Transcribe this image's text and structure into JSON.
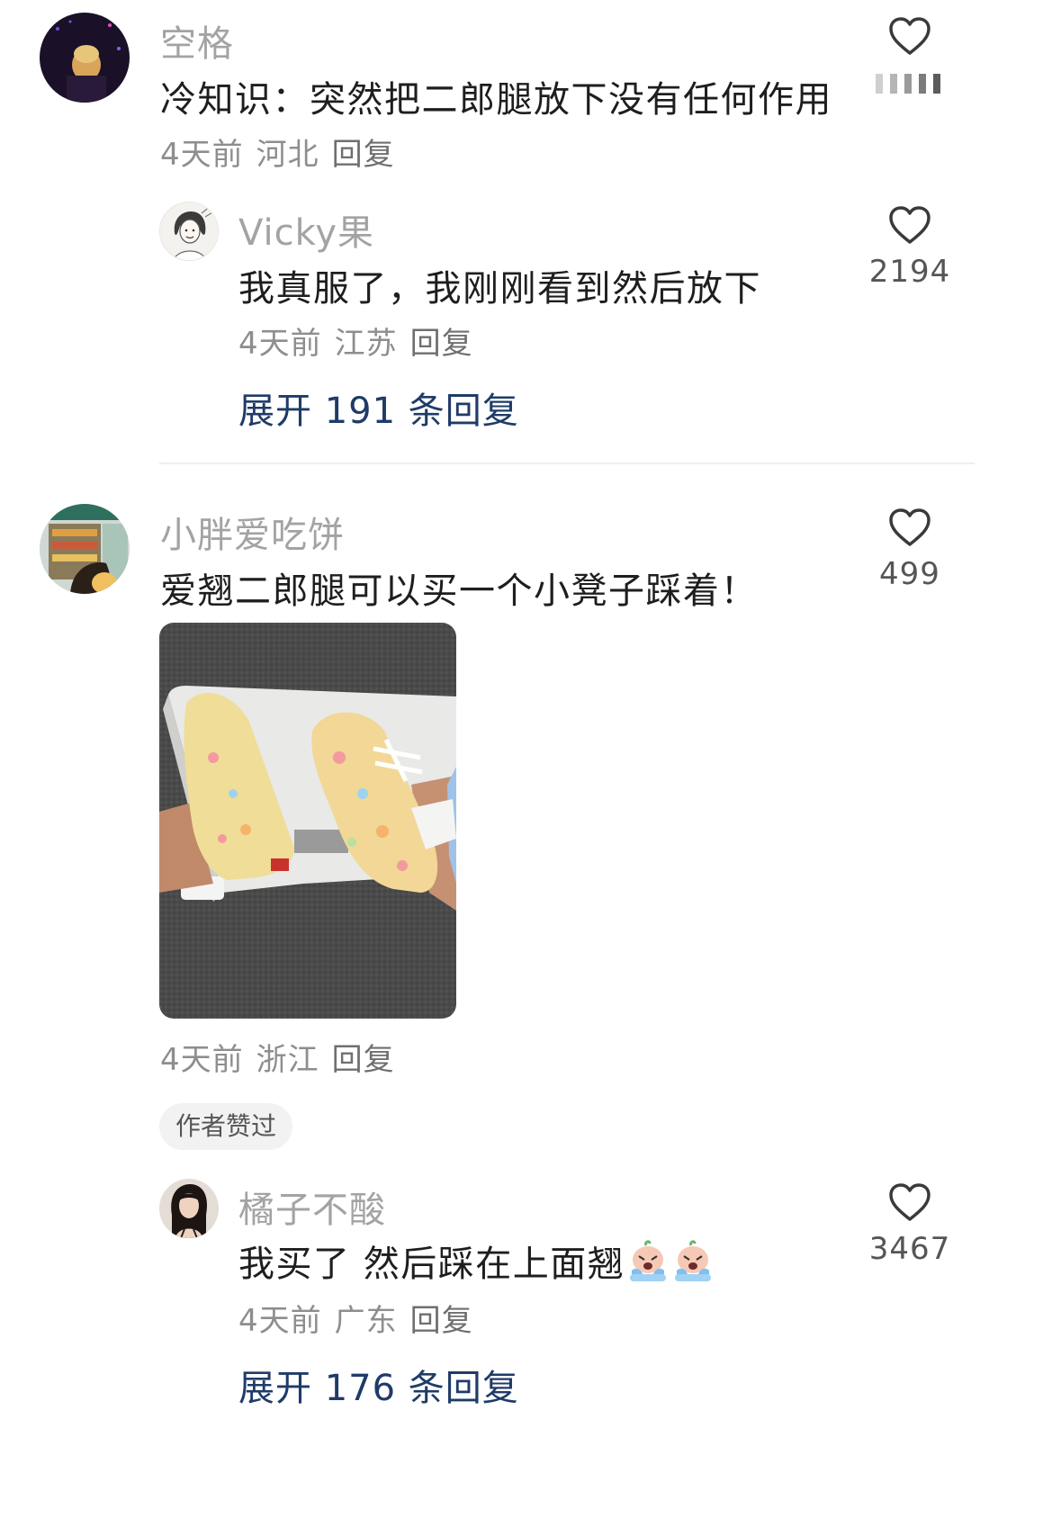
{
  "comments": [
    {
      "username": "空格",
      "text": "冷知识：突然把二郎腿放下没有任何作用",
      "time": "4天前",
      "location": "河北",
      "reply_label": "回复",
      "avatar_icon": "concert-avatar",
      "replies": [
        {
          "username": "Vicky果",
          "text": "我真服了，我刚刚看到然后放下",
          "time": "4天前",
          "location": "江苏",
          "reply_label": "回复",
          "likes": "2194",
          "avatar_icon": "sketch-avatar"
        }
      ],
      "expand_label": "展开 191 条回复"
    },
    {
      "username": "小胖爱吃饼",
      "text": "爱翘二郎腿可以买一个小凳子踩着！",
      "time": "4天前",
      "location": "浙江",
      "reply_label": "回复",
      "likes": "499",
      "avatar_icon": "store-avatar",
      "image_icon": "sneakers-on-footstool-photo",
      "replies": [
        {
          "badge": "作者赞过",
          "username": "橘子不酸",
          "text": "我买了 然后踩在上面翘",
          "emojis": [
            "crying-emoji",
            "crying-emoji"
          ],
          "time": "4天前",
          "location": "广东",
          "reply_label": "回复",
          "likes": "3467",
          "avatar_icon": "portrait-avatar"
        }
      ],
      "expand_label": "展开 176 条回复"
    }
  ],
  "icons": {
    "like": "heart-outline-icon",
    "like_loading": "loading-bars-icon"
  },
  "colors": {
    "link": "#1f3b68",
    "username": "#a3a3a3",
    "meta": "#8e8e8e"
  }
}
